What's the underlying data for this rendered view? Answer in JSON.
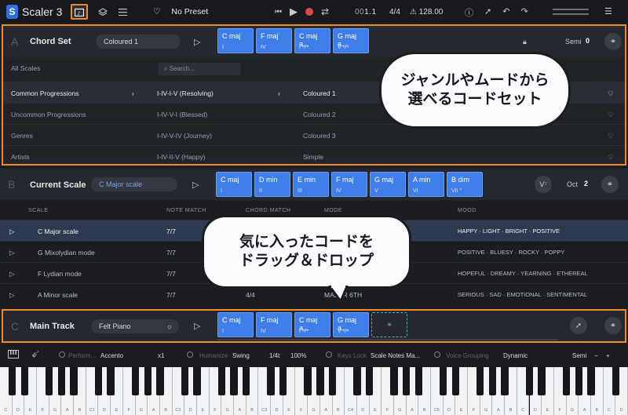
{
  "app": {
    "name": "Scaler 3",
    "preset": "No Preset"
  },
  "transport": {
    "position_dim": "00",
    "position": "1.1",
    "time_signature": "4/4",
    "bpm": "128.00"
  },
  "chord_set": {
    "letter": "A",
    "title": "Chord Set",
    "dropdown": "Coloured 1",
    "chords": [
      {
        "name": "C maj",
        "degree": "I"
      },
      {
        "name": "F maj",
        "degree": "IV"
      },
      {
        "name": "C maj a...",
        "degree": "I ⁶/⁴"
      },
      {
        "name": "G maj a...",
        "degree": "V ⁶/⁴"
      }
    ],
    "semi_label": "Semi",
    "semi_value": "0",
    "categories": [
      "All Scales",
      "Common Progressions",
      "Uncommon Progressions",
      "Genres",
      "Artists"
    ],
    "search_placeholder": "Search...",
    "progressions": [
      "I-IV-I-V (Resolving)",
      "I-IV-V-I (Blessed)",
      "I-IV-V-IV (Journey)",
      "I-IV-II-V (Happy)"
    ],
    "sets": [
      "Coloured 1",
      "Coloured 2",
      "Coloured 3",
      "Simple"
    ]
  },
  "current_scale": {
    "letter": "B",
    "title": "Current Scale",
    "dropdown": "C Major scale",
    "chords": [
      {
        "name": "C maj",
        "degree": "I"
      },
      {
        "name": "D min",
        "degree": "II"
      },
      {
        "name": "E min",
        "degree": "III"
      },
      {
        "name": "F maj",
        "degree": "IV"
      },
      {
        "name": "G maj",
        "degree": "V"
      },
      {
        "name": "A min",
        "degree": "VI"
      },
      {
        "name": "B dim",
        "degree": "VII °"
      }
    ],
    "badge": "V⁷",
    "oct_label": "Oct",
    "oct_value": "2"
  },
  "scale_table": {
    "headers": {
      "scale": "SCALE",
      "note_match": "NOTE MATCH",
      "chord_match": "CHORD MATCH",
      "mode": "MODE",
      "mood": "MOOD"
    },
    "rows": [
      {
        "scale": "C Major scale",
        "note_match": "7/7",
        "chord_match": "",
        "mode": "",
        "mood": "HAPPY · LIGHT · BRIGHT · POSITIVE"
      },
      {
        "scale": "G Mixolydian mode",
        "note_match": "7/7",
        "chord_match": "",
        "mode": "",
        "mood": "POSITIVE · BLUESY · ROCKY · POPPY"
      },
      {
        "scale": "F Lydian mode",
        "note_match": "7/7",
        "chord_match": "",
        "mode": "",
        "mood": "HOPEFUL · DREAMY · YEARNING · ETHEREAL"
      },
      {
        "scale": "A Minor scale",
        "note_match": "7/7",
        "chord_match": "4/4",
        "mode": "MAJOR 6TH",
        "mood": "SERIOUS · SAD · EMOTIONAL · SENTIMENTAL"
      }
    ]
  },
  "main_track": {
    "letter": "C",
    "title": "Main Track",
    "instrument": "Felt Piano",
    "chords": [
      {
        "name": "C maj",
        "degree": "I"
      },
      {
        "name": "F maj",
        "degree": "IV"
      },
      {
        "name": "C maj a...",
        "degree": "I ⁶/⁴"
      },
      {
        "name": "G maj a...",
        "degree": "V ⁶/⁴"
      }
    ]
  },
  "controls": {
    "perform_label": "Perform...",
    "perform_value": "Accento",
    "perform_mult": "x1",
    "humanize_label": "Humanize",
    "humanize_value": "Swing",
    "swing_div": "1/4t",
    "swing_amount": "100%",
    "keys_lock_label": "Keys Lock",
    "keys_lock_value": "Scale Notes Ma...",
    "voice_label": "Voice Grouping",
    "voice_value": "Dynamic",
    "semi_label": "Semi",
    "minus": "−",
    "plus": "+"
  },
  "keyboard": {
    "labels": [
      "C1",
      "C2",
      "C3",
      "C4",
      "C5"
    ]
  },
  "callouts": {
    "top": [
      "ジャンルやムードから",
      "選べるコードセット"
    ],
    "middle": [
      "気に入ったコードを",
      "ドラッグ＆ドロップ"
    ]
  },
  "colors": {
    "accent": "#f08a2a",
    "chord": "#3f7ee8",
    "brand": "#2f6fe0"
  }
}
